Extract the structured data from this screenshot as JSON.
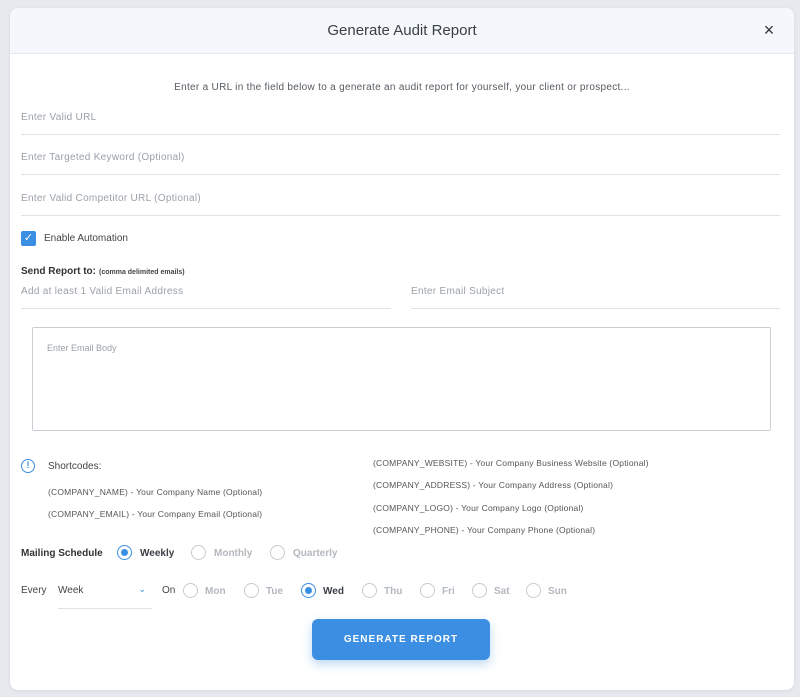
{
  "modal": {
    "title": "Generate Audit Report",
    "close_glyph": "×",
    "intro": "Enter a URL in the field below to a generate an audit report for yourself, your client or prospect..."
  },
  "fields": {
    "url_placeholder": "Enter Valid URL",
    "keyword_placeholder": "Enter Targeted Keyword (Optional)",
    "competitor_placeholder": "Enter Valid Competitor URL (Optional)",
    "email_placeholder": "Add at least 1 Valid Email Address",
    "subject_placeholder": "Enter Email Subject",
    "body_placeholder": "Enter Email Body"
  },
  "automation": {
    "label": "Enable Automation",
    "checked": true,
    "check_glyph": "✓"
  },
  "send": {
    "label": "Send Report to:",
    "note": "(comma delimited emails)"
  },
  "shortcodes": {
    "title": "Shortcodes:",
    "info_glyph": "!",
    "left": [
      "(COMPANY_NAME) - Your Company Name (Optional)",
      "(COMPANY_EMAIL) - Your Company Email (Optional)"
    ],
    "right": [
      "(COMPANY_WEBSITE) - Your Company Business Website (Optional)",
      "(COMPANY_ADDRESS) - Your Company Address (Optional)",
      "(COMPANY_LOGO) - Your Company Logo (Optional)",
      "(COMPANY_PHONE) - Your Company Phone (Optional)"
    ]
  },
  "schedule": {
    "label": "Mailing Schedule",
    "options": [
      "Weekly",
      "Monthly",
      "Quarterly"
    ],
    "selected": "Weekly"
  },
  "every": {
    "label": "Every",
    "select_value": "Week",
    "chevron": "⌄",
    "on_label": "On",
    "days": [
      "Mon",
      "Tue",
      "Wed",
      "Thu",
      "Fri",
      "Sat",
      "Sun"
    ],
    "selected_day": "Wed"
  },
  "button": {
    "label": "GENERATE REPORT"
  },
  "colors": {
    "accent": "#3a8fe3",
    "header_bg": "#f4f7fb"
  }
}
